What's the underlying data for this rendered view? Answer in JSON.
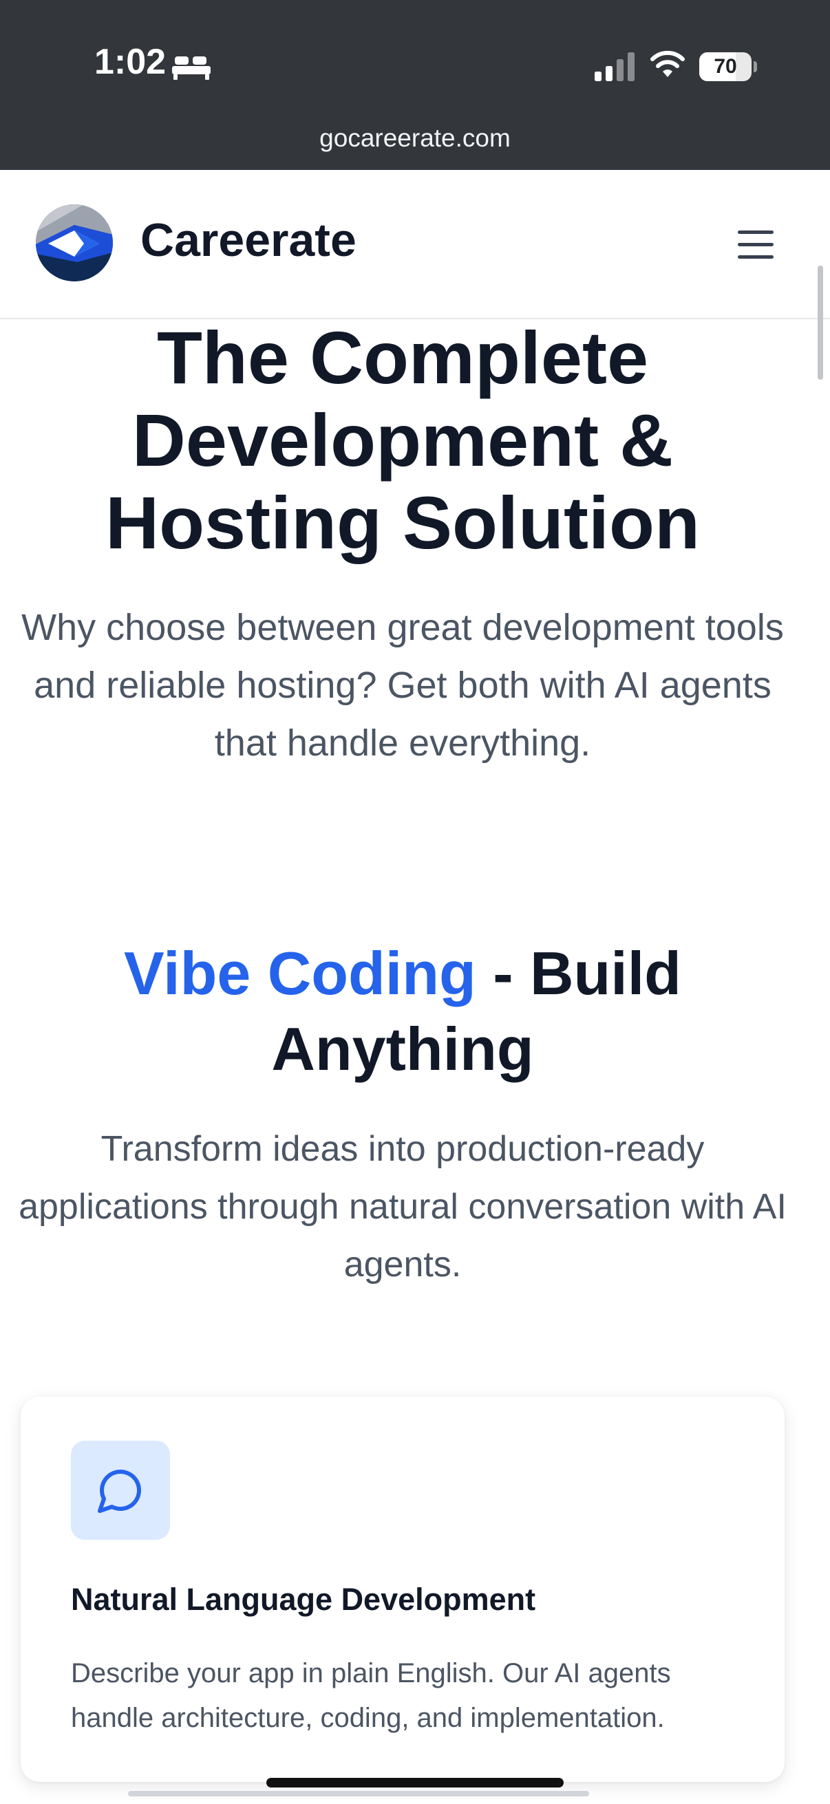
{
  "status_bar": {
    "time": "1:02",
    "battery_level": "70",
    "battery_fraction": 0.7,
    "icons": [
      "sleep-icon",
      "signal-icon",
      "wifi-icon",
      "battery-icon"
    ]
  },
  "browser": {
    "url": "gocareerate.com"
  },
  "header": {
    "brand": "Careerate",
    "logo_icon": "careerate-logo",
    "menu_icon": "hamburger-menu-icon"
  },
  "hero": {
    "title": "The Complete Development & Hosting Solution",
    "subtitle": "Why choose between great development tools and reliable hosting? Get both with AI agents that handle everything."
  },
  "section": {
    "title_highlight": "Vibe Coding",
    "title_rest": " - Build Anything",
    "subtitle": "Transform ideas into production-ready applications through natural conversation with AI agents."
  },
  "feature_card": {
    "icon": "chat-bubble-icon",
    "title": "Natural Language Development",
    "description": "Describe your app in plain English. Our AI agents handle architecture, coding, and implementation."
  },
  "colors": {
    "accent": "#2563eb",
    "status_bar": "#33373b",
    "heading": "#111827",
    "body_text": "#4b5563",
    "icon_box": "#dbeafe"
  }
}
